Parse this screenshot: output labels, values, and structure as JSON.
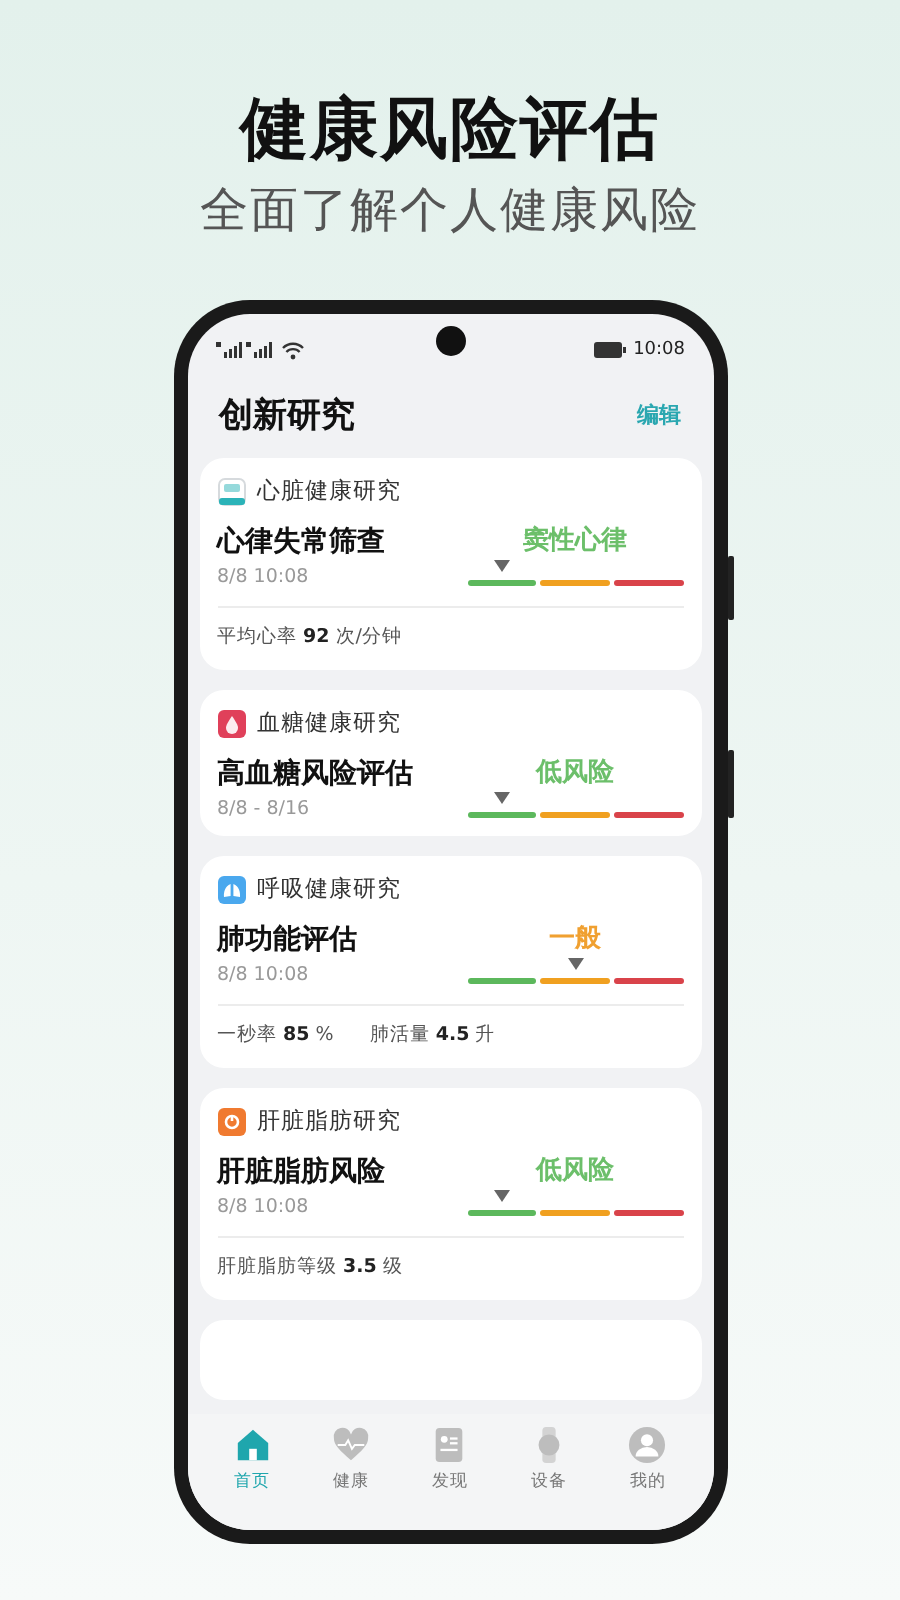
{
  "headline": "健康风险评估",
  "subheadline": "全面了解个人健康风险",
  "status_bar": {
    "time": "10:08"
  },
  "page": {
    "title": "创新研究",
    "action": "编辑"
  },
  "cards": [
    {
      "icon": {
        "kind": "app",
        "color": "#2bb3b8"
      },
      "category": "心脏健康研究",
      "title": "心律失常筛查",
      "date": "8/8 10:08",
      "result": {
        "text": "窦性心律",
        "color": "#6cbf6a"
      },
      "level": 0.16,
      "metrics": [
        {
          "label": "平均心率",
          "value": "92",
          "unit": "次/分钟"
        }
      ]
    },
    {
      "icon": {
        "kind": "drop",
        "color": "#e0405a"
      },
      "category": "血糖健康研究",
      "title": "高血糖风险评估",
      "date": "8/8 - 8/16",
      "result": {
        "text": "低风险",
        "color": "#6cbf6a"
      },
      "level": 0.16
    },
    {
      "icon": {
        "kind": "lungs",
        "color": "#4aa8ee"
      },
      "category": "呼吸健康研究",
      "title": "肺功能评估",
      "date": "8/8 10:08",
      "result": {
        "text": "一般",
        "color": "#f0a030"
      },
      "level": 0.5,
      "metrics": [
        {
          "label": "一秒率",
          "value": "85",
          "unit": "%"
        },
        {
          "label": "肺活量",
          "value": "4.5",
          "unit": "升"
        }
      ]
    },
    {
      "icon": {
        "kind": "power",
        "color": "#f07a30"
      },
      "category": "肝脏脂肪研究",
      "title": "肝脏脂肪风险",
      "date": "8/8 10:08",
      "result": {
        "text": "低风险",
        "color": "#6cbf6a"
      },
      "level": 0.16,
      "metrics": [
        {
          "label": "肝脏脂肪等级",
          "value": "3.5",
          "unit": "级"
        }
      ]
    }
  ],
  "tabs": [
    {
      "kind": "home",
      "label": "首页",
      "selected": true
    },
    {
      "kind": "health",
      "label": "健康",
      "selected": false
    },
    {
      "kind": "discover",
      "label": "发现",
      "selected": false
    },
    {
      "kind": "device",
      "label": "设备",
      "selected": false
    },
    {
      "kind": "me",
      "label": "我的",
      "selected": false
    }
  ]
}
